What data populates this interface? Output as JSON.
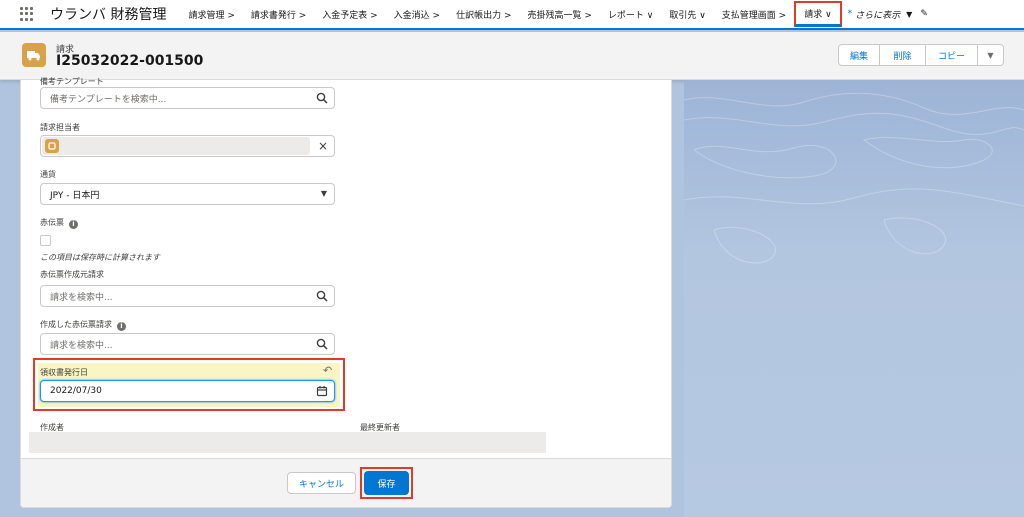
{
  "nav": {
    "app_name": "ウランバ 財務管理",
    "items": [
      {
        "label": "請求管理 >"
      },
      {
        "label": "請求書発行 >"
      },
      {
        "label": "入金予定表 >"
      },
      {
        "label": "入金消込 >"
      },
      {
        "label": "仕訳帳出力 >"
      },
      {
        "label": "売掛残高一覧 >"
      },
      {
        "label": "レポート ∨"
      },
      {
        "label": "取引先 ∨"
      },
      {
        "label": "支払管理画面 >"
      },
      {
        "label": "請求 ∨"
      }
    ],
    "more_star": "*",
    "more_label": "さらに表示",
    "more_caret": "▼",
    "edit_glyph": "✎"
  },
  "record": {
    "type_label": "請求",
    "title": "I25032022-001500",
    "buttons": {
      "edit": "編集",
      "delete": "削除",
      "copy": "コピー",
      "dropdown": "▼"
    }
  },
  "form": {
    "remarks_template": {
      "label": "備考テンプレート",
      "placeholder": "備考テンプレートを検索中..."
    },
    "billing_owner": {
      "label": "請求担当者",
      "clear": "×"
    },
    "currency": {
      "label": "通貨",
      "value": "JPY - 日本円",
      "caret": "▼"
    },
    "red_slip": {
      "label": "赤伝票",
      "help": "この項目は保存時に計算されます"
    },
    "red_slip_source": {
      "label": "赤伝票作成元請求",
      "placeholder": "請求を検索中..."
    },
    "created_red_slip": {
      "label": "作成した赤伝票請求",
      "placeholder": "請求を検索中..."
    },
    "receipt_date": {
      "label": "領収書発行日",
      "value": "2022/07/30",
      "undo": "↶"
    },
    "created_by": {
      "label": "作成者"
    },
    "last_modified_by": {
      "label": "最終更新者"
    }
  },
  "footer": {
    "cancel": "キャンセル",
    "save": "保存"
  },
  "colors": {
    "brand": "#0176d3",
    "highlight": "#e03b24",
    "icon_bg": "#d9a248",
    "field_changed": "#f9f5c4"
  },
  "icons": [
    "app-launcher-icon",
    "record-type-icon",
    "search-icon",
    "clear-icon",
    "chevron-down-icon",
    "info-icon",
    "calendar-icon",
    "undo-icon",
    "pencil-icon"
  ]
}
